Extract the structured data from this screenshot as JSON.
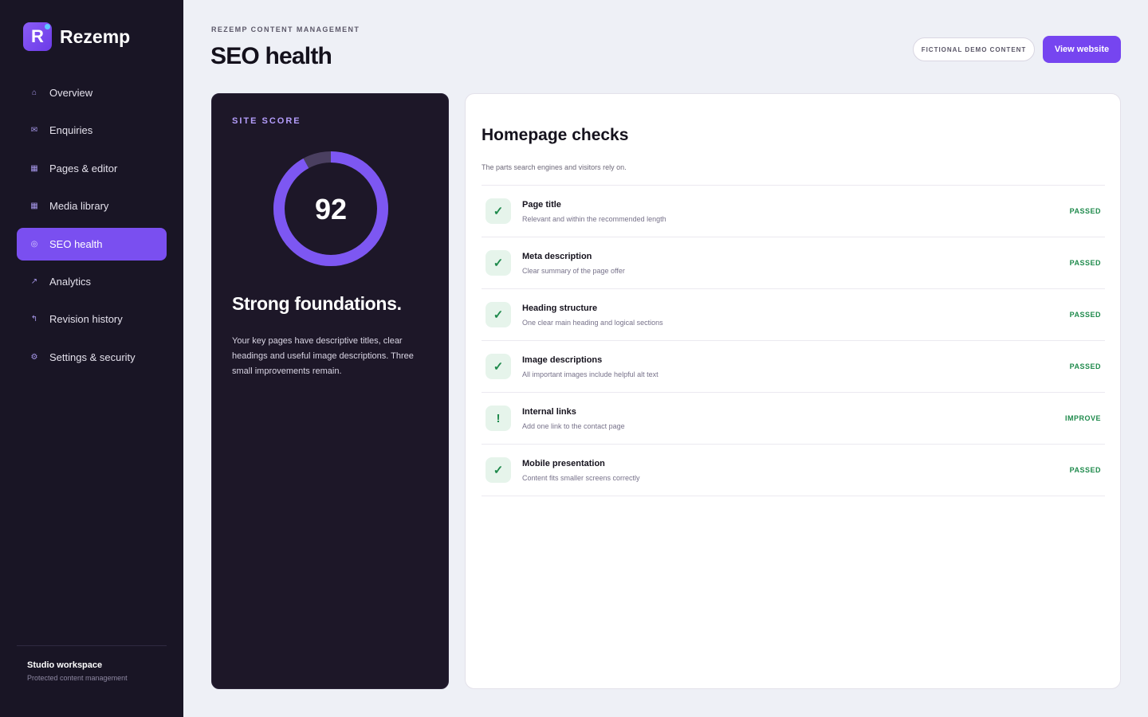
{
  "brand": {
    "logo_letter": "R",
    "name": "Rezemp"
  },
  "sidebar": {
    "items": [
      {
        "label": "Overview",
        "icon": "⌂",
        "icon_name": "home-icon"
      },
      {
        "label": "Enquiries",
        "icon": "✉",
        "icon_name": "mail-icon"
      },
      {
        "label": "Pages & editor",
        "icon": "▦",
        "icon_name": "pages-icon"
      },
      {
        "label": "Media library",
        "icon": "▦",
        "icon_name": "media-icon"
      },
      {
        "label": "SEO health",
        "icon": "◎",
        "icon_name": "target-icon",
        "active": true
      },
      {
        "label": "Analytics",
        "icon": "↗",
        "icon_name": "trend-icon"
      },
      {
        "label": "Revision history",
        "icon": "↰",
        "icon_name": "history-icon"
      },
      {
        "label": "Settings & security",
        "icon": "⚙",
        "icon_name": "gear-icon"
      }
    ],
    "footer": {
      "title": "Studio workspace",
      "subtitle": "Protected content management"
    }
  },
  "header": {
    "eyebrow": "REZEMP CONTENT MANAGEMENT",
    "title": "SEO health",
    "badge": "FICTIONAL DEMO CONTENT",
    "view_button": "View website"
  },
  "score": {
    "eyebrow": "SITE SCORE",
    "value": 92,
    "value_text": "92",
    "max": 100,
    "heading": "Strong foundations.",
    "text": "Your key pages have descriptive titles, clear headings and useful image descriptions. Three small improvements remain."
  },
  "checks": {
    "title": "Homepage checks",
    "subtitle": "The parts search engines and visitors rely on.",
    "items": [
      {
        "name": "Page title",
        "desc": "Relevant and within the recommended length",
        "status": "PASSED",
        "icon": "✓"
      },
      {
        "name": "Meta description",
        "desc": "Clear summary of the page offer",
        "status": "PASSED",
        "icon": "✓"
      },
      {
        "name": "Heading structure",
        "desc": "One clear main heading and logical sections",
        "status": "PASSED",
        "icon": "✓"
      },
      {
        "name": "Image descriptions",
        "desc": "All important images include helpful alt text",
        "status": "PASSED",
        "icon": "✓"
      },
      {
        "name": "Internal links",
        "desc": "Add one link to the contact page",
        "status": "IMPROVE",
        "icon": "!"
      },
      {
        "name": "Mobile presentation",
        "desc": "Content fits smaller screens correctly",
        "status": "PASSED",
        "icon": "✓"
      }
    ]
  },
  "colors": {
    "accent": "#7645f0",
    "sidebar_bg": "#191525",
    "score_card_bg": "#1d1728",
    "success": "#1f8a4c",
    "gauge_track": "#4a3f60"
  }
}
